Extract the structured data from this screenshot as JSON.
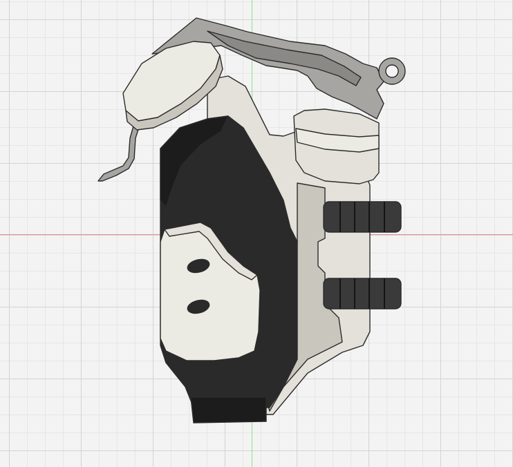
{
  "viewport": {
    "background": "#f3f3f3",
    "grid_major_color": "#d3d3d3",
    "grid_minor_color": "#e6e6e6",
    "x_axis_color": "#ef8e8e",
    "y_axis_color": "#8fdf8f"
  },
  "model": {
    "description_icon": "grenade-3d-model",
    "colors": {
      "body_light": "#e3e1d9",
      "body_shadow": "#c9c6bd",
      "cream": "#ecebe3",
      "dark": "#2a2a2a",
      "dark_shadow": "#1c1c1c",
      "lever": "#a7a5a1",
      "lever_dark": "#8b8985",
      "edge": "#2b2b2b"
    }
  }
}
